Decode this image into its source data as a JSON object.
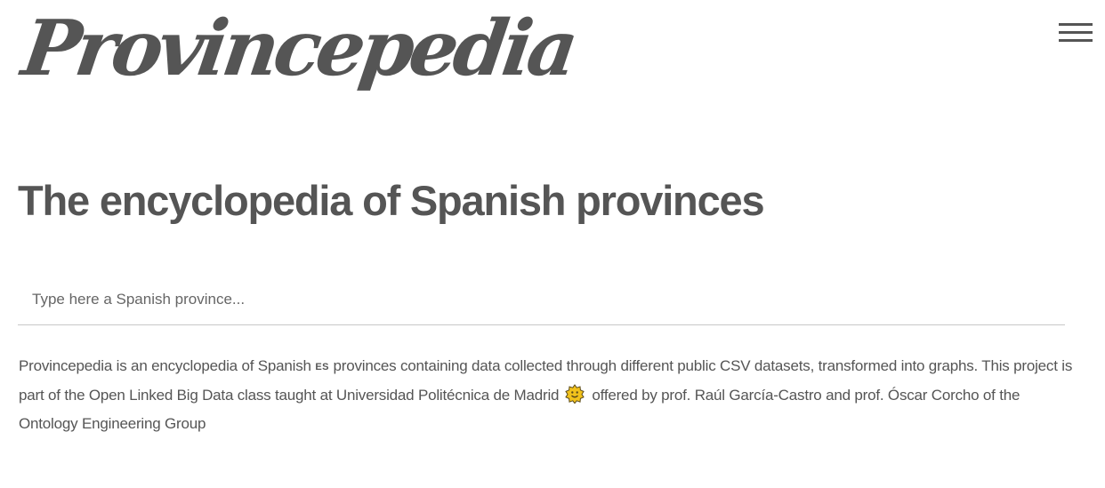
{
  "header": {
    "logo_text": "Provincepedia",
    "menu_icon": "hamburger-menu-icon"
  },
  "main": {
    "title": "The encyclopedia of Spanish provinces",
    "search": {
      "placeholder": "Type here a Spanish province...",
      "value": ""
    },
    "description": {
      "part1": "Provincepedia is an encyclopedia of Spanish ",
      "flag_code": "ES",
      "part2": " provinces containing data collected through different public CSV datasets, transformed into graphs. This project is part of the Open Linked Big Data class taught at ",
      "university": "Universidad Politécnica de Madrid",
      "university_icon": "upm-emblem-icon",
      "part3": " offered by prof. ",
      "prof1": "Raúl García-Castro",
      "part4": " and prof. ",
      "prof2": "Óscar Corcho",
      "part5": " of the ",
      "group": "Ontology Engineering Group"
    }
  },
  "colors": {
    "text": "#555555",
    "emblem_fill": "#f2c21b",
    "emblem_outline": "#5a4a1a",
    "search_border": "#c8c8c8"
  }
}
